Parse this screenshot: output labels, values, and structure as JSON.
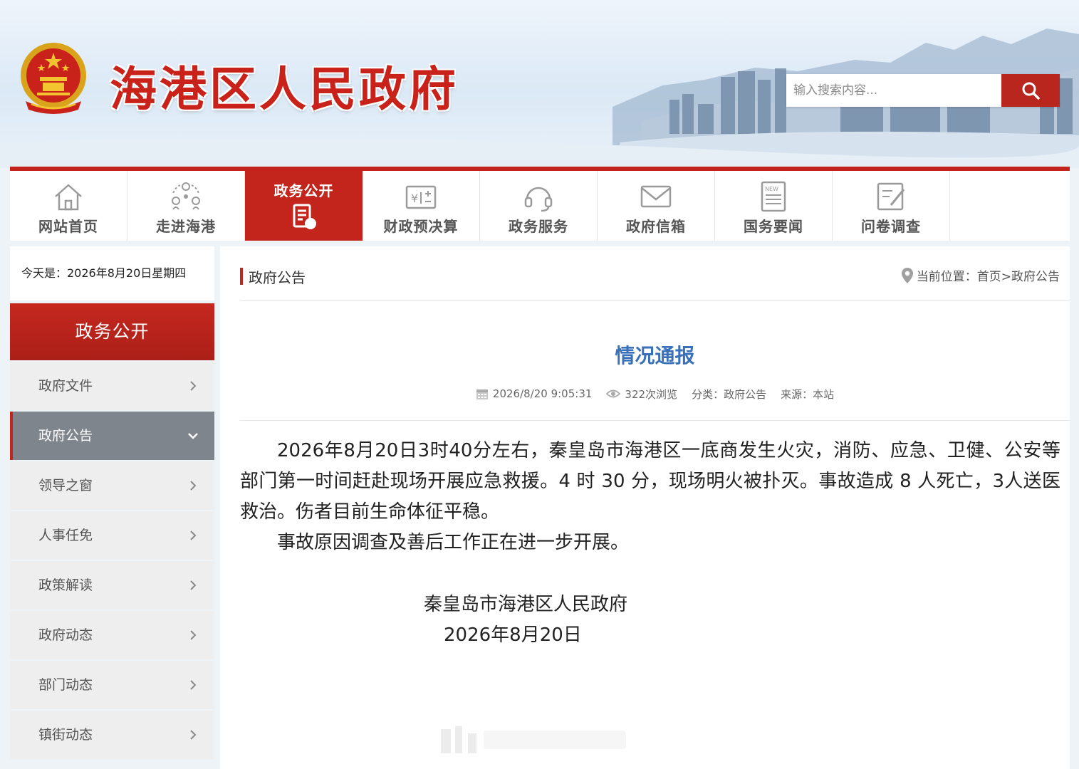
{
  "header": {
    "site_title": "海港区人民政府",
    "search_placeholder": "输入搜索内容..."
  },
  "nav": {
    "items": [
      {
        "label": "网站首页",
        "icon": "home-icon"
      },
      {
        "label": "走进海港",
        "icon": "network-icon"
      },
      {
        "label": "政务公开",
        "icon": "document-icon",
        "active": true
      },
      {
        "label": "财政预决算",
        "icon": "finance-icon"
      },
      {
        "label": "政务服务",
        "icon": "headset-icon"
      },
      {
        "label": "政府信箱",
        "icon": "mail-icon"
      },
      {
        "label": "国务要闻",
        "icon": "newspaper-icon"
      },
      {
        "label": "问卷调查",
        "icon": "survey-icon"
      }
    ]
  },
  "sidebar": {
    "today": "今天是：2026年8月20日星期四",
    "heading": "政务公开",
    "items": [
      {
        "label": "政府文件"
      },
      {
        "label": "政府公告",
        "active": true
      },
      {
        "label": "领导之窗"
      },
      {
        "label": "人事任免"
      },
      {
        "label": "政策解读"
      },
      {
        "label": "政府动态"
      },
      {
        "label": "部门动态"
      },
      {
        "label": "镇街动态"
      }
    ]
  },
  "main": {
    "section_title": "政府公告",
    "location": "当前位置：首页>政府公告",
    "article": {
      "title": "情况通报",
      "datetime": "2026/8/20 9:05:31",
      "views": "322次浏览",
      "category": "分类：政府公告",
      "source": "来源：本站",
      "paragraph1": "2026年8月20日3时40分左右，秦皇岛市海港区一底商发生火灾，消防、应急、卫健、公安等部门第一时间赶赴现场开展应急救援。4 时 30 分，现场明火被扑灭。事故造成 8 人死亡，3人送医救治。伤者目前生命体征平稳。",
      "paragraph2": "事故原因调查及善后工作正在进一步开展。",
      "signature": "秦皇岛市海港区人民政府",
      "sign_date": "2026年8月20日"
    }
  },
  "colors": {
    "brand_red": "#c3251c",
    "title_blue": "#3a70b8",
    "sidebar_active": "#7f858d"
  }
}
